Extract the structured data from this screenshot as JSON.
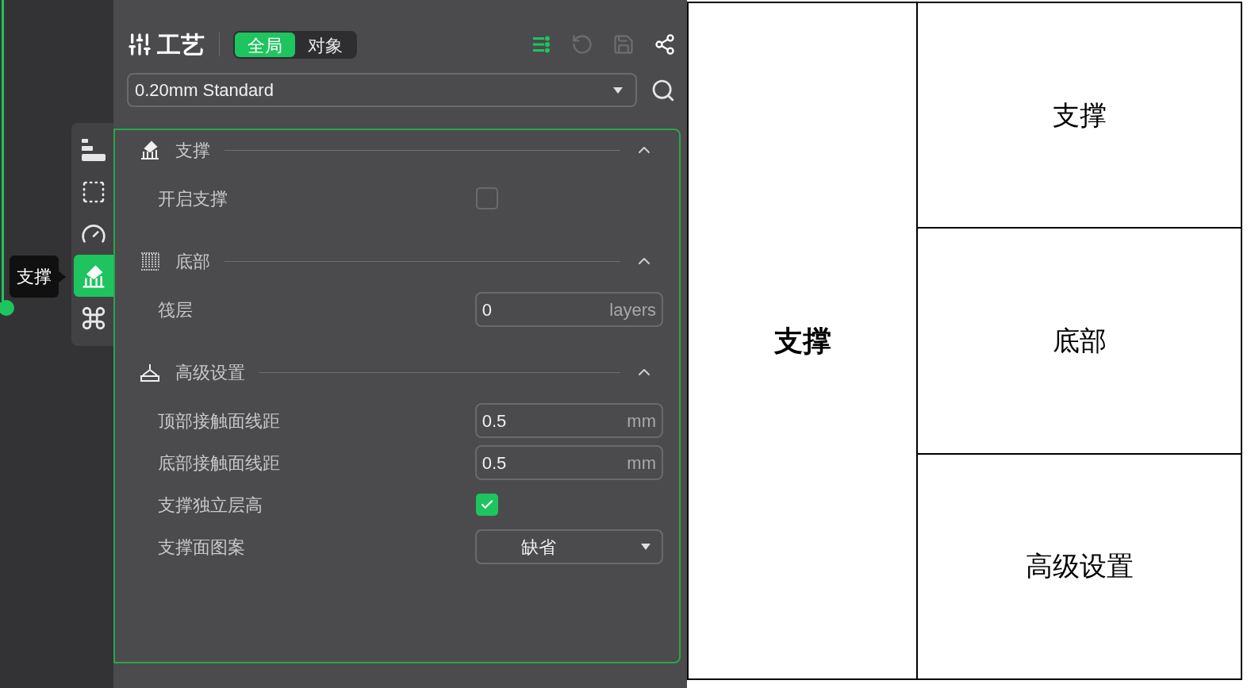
{
  "header": {
    "title": "工艺",
    "scope_tabs": [
      {
        "label": "全局",
        "selected": true
      },
      {
        "label": "对象",
        "selected": false
      }
    ]
  },
  "preset": {
    "value": "0.20mm Standard"
  },
  "side_tabs": [
    {
      "kind": "quality",
      "selected": false
    },
    {
      "kind": "strength",
      "selected": false
    },
    {
      "kind": "speed",
      "selected": false
    },
    {
      "kind": "support",
      "selected": true
    },
    {
      "kind": "others",
      "selected": false
    }
  ],
  "tooltip": "支撑",
  "sections": [
    {
      "kind": "support",
      "title": "支撑",
      "expanded": true,
      "rows": [
        {
          "kind": "checkbox",
          "label": "开启支撑",
          "checked": false
        }
      ]
    },
    {
      "kind": "base",
      "title": "底部",
      "expanded": true,
      "rows": [
        {
          "kind": "number",
          "label": "筏层",
          "value": "0",
          "unit": "layers"
        }
      ]
    },
    {
      "kind": "advanced",
      "title": "高级设置",
      "expanded": true,
      "rows": [
        {
          "kind": "number",
          "label": "顶部接触面线距",
          "value": "0.5",
          "unit": "mm"
        },
        {
          "kind": "number",
          "label": "底部接触面线距",
          "value": "0.5",
          "unit": "mm"
        },
        {
          "kind": "checkbox",
          "label": "支撑独立层高",
          "checked": true
        },
        {
          "kind": "select",
          "label": "支撑面图案",
          "value": "缺省"
        }
      ]
    }
  ],
  "table": {
    "group": "支撑",
    "items": [
      "支撑",
      "底部",
      "高级设置"
    ]
  }
}
